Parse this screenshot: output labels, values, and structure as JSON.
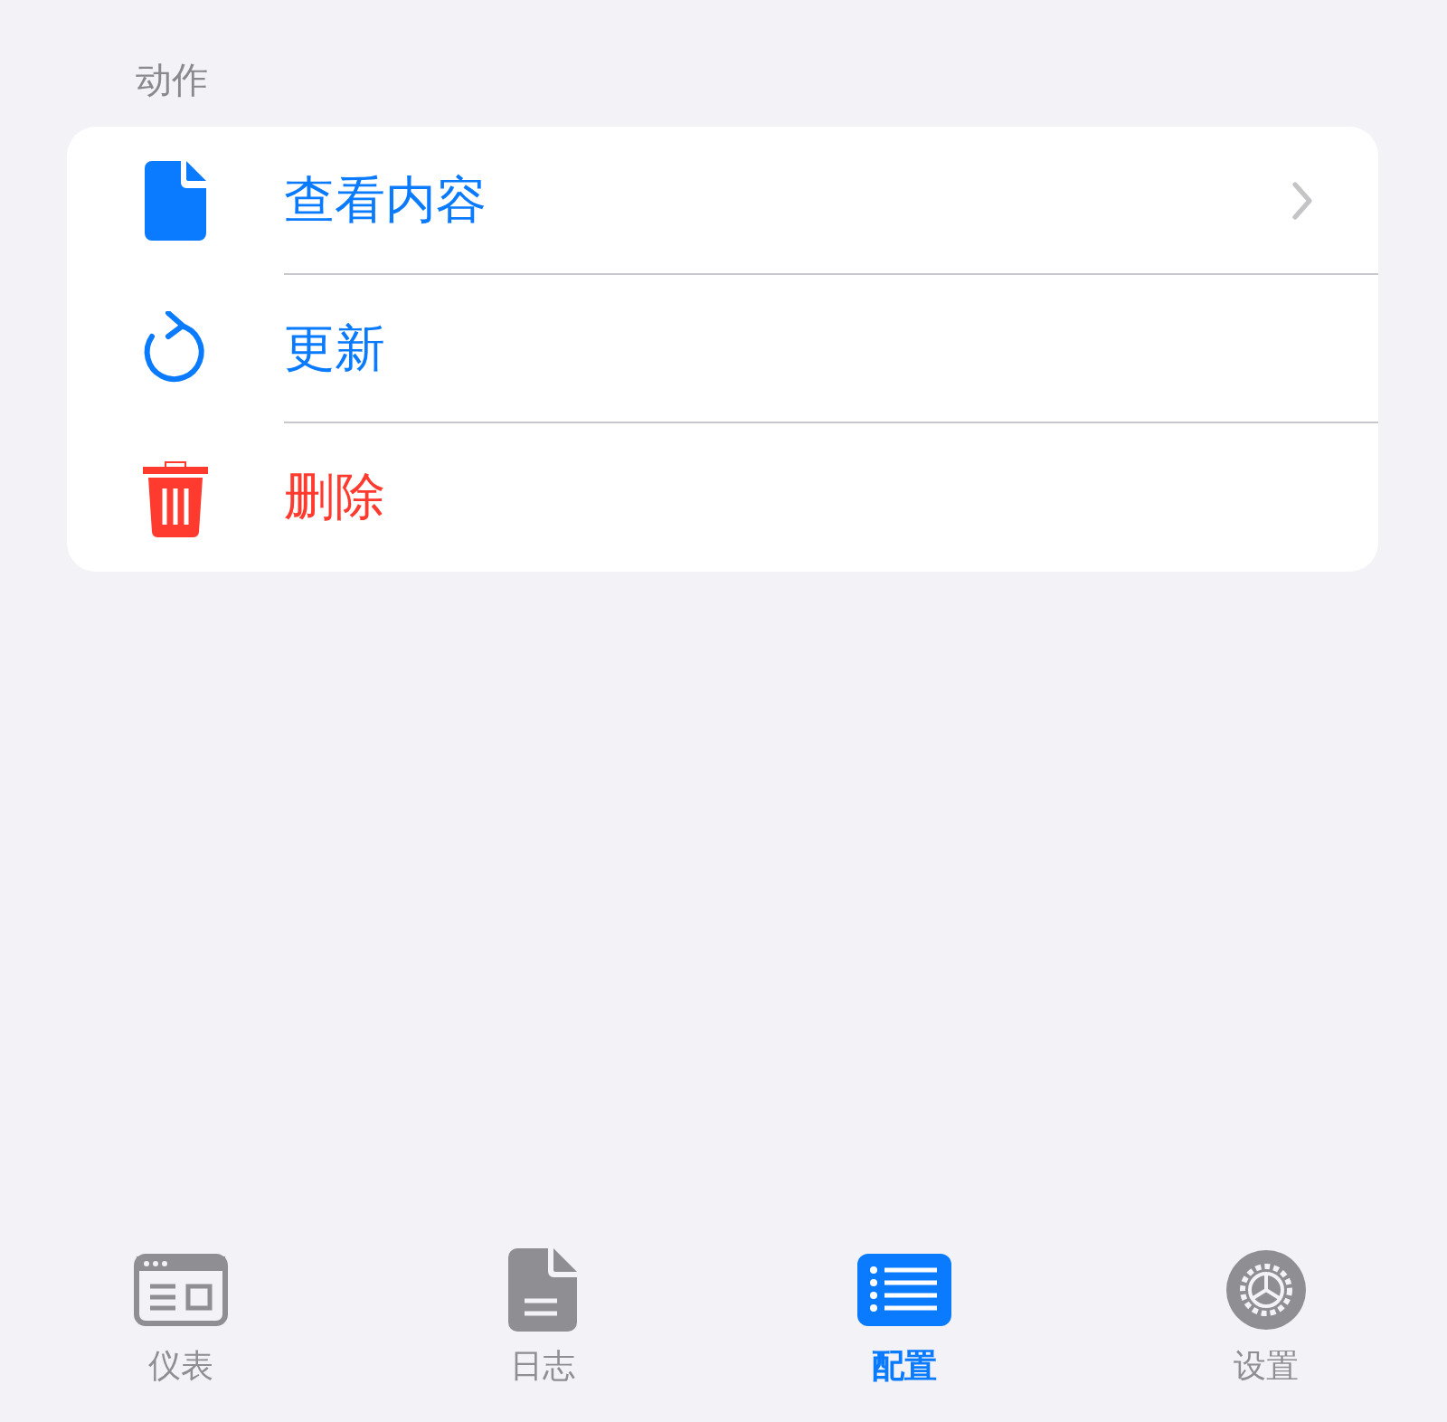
{
  "section": {
    "header": "动作"
  },
  "actions": [
    {
      "kind": "open",
      "label": "查看内容"
    },
    {
      "kind": "refresh",
      "label": "更新"
    },
    {
      "kind": "destructive",
      "label": "删除"
    }
  ],
  "tab_bar": [
    {
      "label": "仪表",
      "selected": false
    },
    {
      "label": "日志",
      "selected": false
    },
    {
      "label": "配置",
      "selected": true
    },
    {
      "label": "设置",
      "selected": false
    }
  ]
}
